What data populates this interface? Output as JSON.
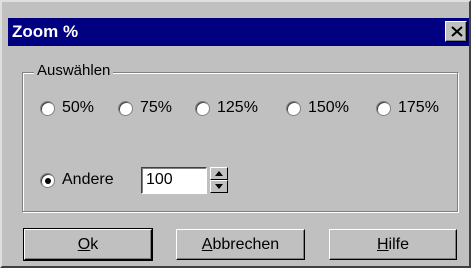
{
  "window": {
    "title": "Zoom %"
  },
  "group": {
    "label": "Auswählen",
    "options": [
      {
        "label": "50%",
        "checked": false
      },
      {
        "label": "75%",
        "checked": false
      },
      {
        "label": "125%",
        "checked": false
      },
      {
        "label": "150%",
        "checked": false
      },
      {
        "label": "175%",
        "checked": false
      }
    ],
    "other": {
      "label": "Andere",
      "checked": true,
      "value": "100"
    }
  },
  "buttons": {
    "ok": {
      "mnemonic": "O",
      "rest": "k"
    },
    "cancel": {
      "mnemonic": "A",
      "rest": "bbrechen"
    },
    "help": {
      "mnemonic": "H",
      "rest": "ilfe"
    }
  }
}
